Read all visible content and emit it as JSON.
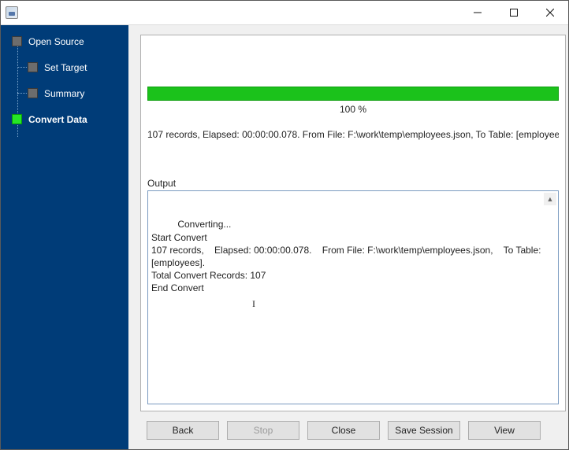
{
  "window": {
    "controls": {
      "min": "Minimize",
      "max": "Maximize",
      "close": "Close"
    }
  },
  "sidebar": {
    "items": [
      {
        "label": "Open Source"
      },
      {
        "label": "Set Target"
      },
      {
        "label": "Summary"
      },
      {
        "label": "Convert Data"
      }
    ]
  },
  "progress": {
    "percent_text": "100 %"
  },
  "status_line": "107 records,    Elapsed: 00:00:00.078.    From File: F:\\work\\temp\\employees.json,    To Table: [employees].",
  "output": {
    "label": "Output",
    "text": "Converting...\nStart Convert\n107 records,    Elapsed: 00:00:00.078.    From File: F:\\work\\temp\\employees.json,    To Table: [employees].\nTotal Convert Records: 107\nEnd Convert"
  },
  "buttons": {
    "back": "Back",
    "stop": "Stop",
    "close": "Close",
    "save_session": "Save Session",
    "view": "View"
  }
}
